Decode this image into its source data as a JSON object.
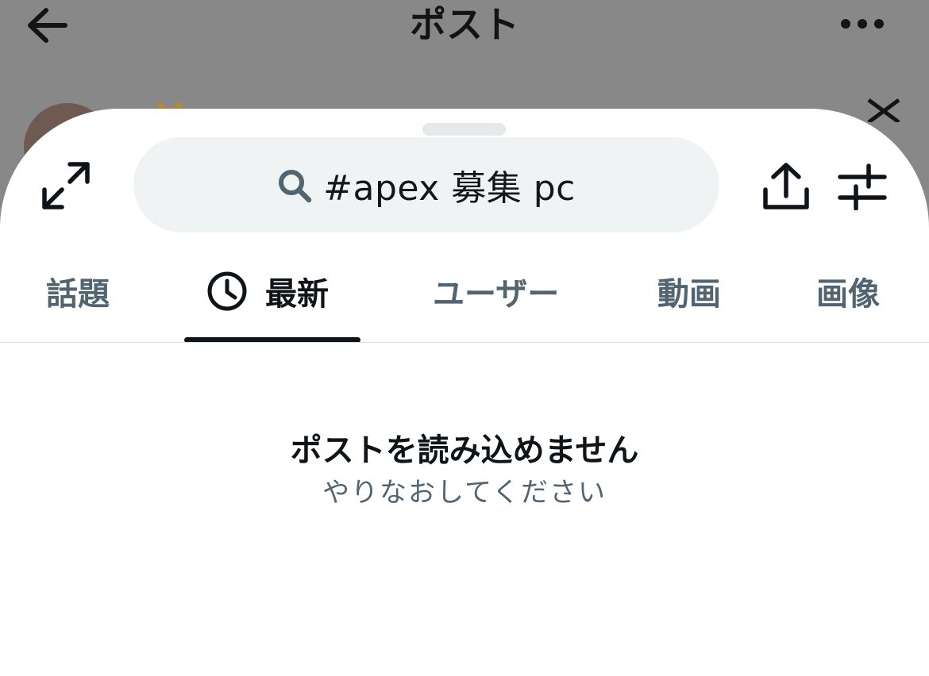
{
  "background": {
    "title": "ポスト",
    "back_icon": "arrow-left-icon",
    "more_icon": "more-horizontal-icon"
  },
  "sheet": {
    "expand_icon": "expand-icon",
    "search": {
      "icon": "search-icon",
      "query": "#apex 募集 pc"
    },
    "share_icon": "share-icon",
    "filter_icon": "filter-sliders-icon",
    "tabs": [
      {
        "label": "話題",
        "active": false
      },
      {
        "label": "最新",
        "active": true,
        "icon": "clock-icon"
      },
      {
        "label": "ユーザー",
        "active": false
      },
      {
        "label": "動画",
        "active": false
      },
      {
        "label": "画像",
        "active": false
      }
    ],
    "empty_state": {
      "title": "ポストを読み込めません",
      "subtitle": "やりなおしてください"
    }
  },
  "colors": {
    "overlay": "#888888",
    "search_bg": "#eff3f4",
    "active_text": "#0f1419",
    "inactive_text": "#536471"
  }
}
